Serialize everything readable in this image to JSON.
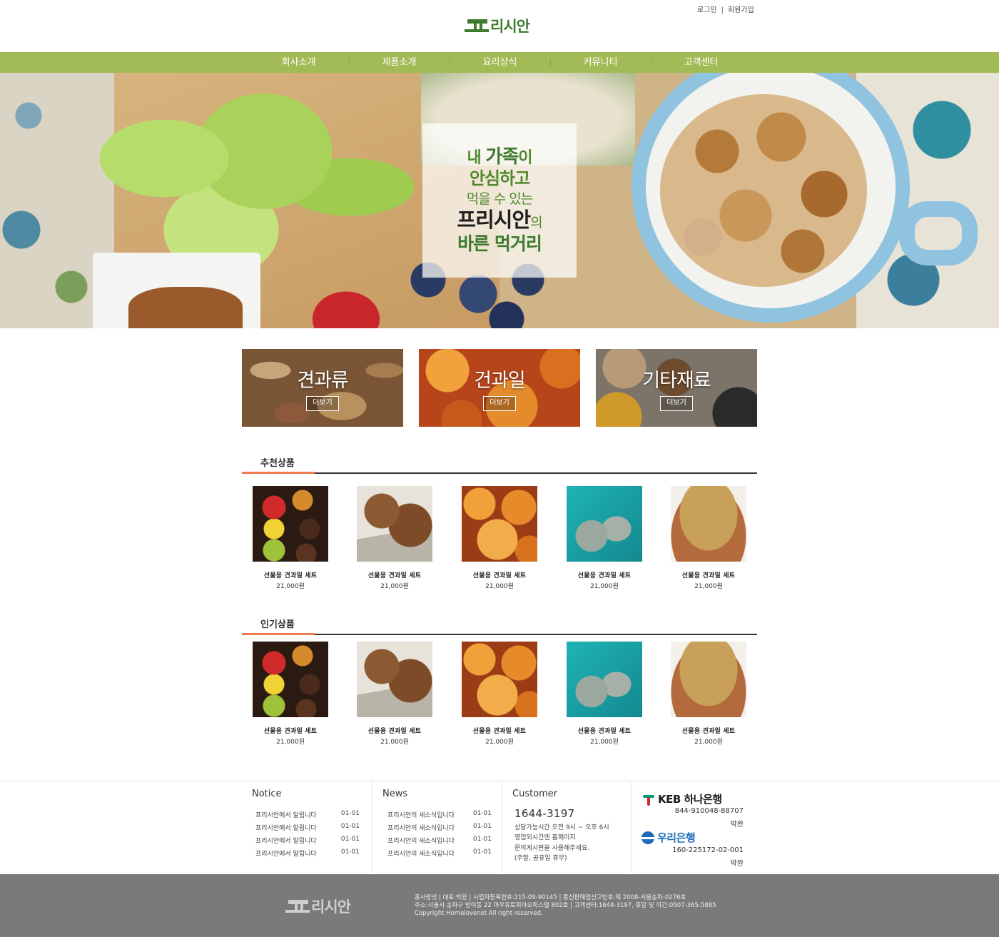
{
  "header": {
    "login_label": "로그인",
    "separator": "|",
    "signup_label": "회원가입",
    "logo_text": "리시안"
  },
  "nav": {
    "items": [
      {
        "label": "회사소개"
      },
      {
        "label": "제품소개"
      },
      {
        "label": "요리상식"
      },
      {
        "label": "커뮤니티"
      },
      {
        "label": "고객센터"
      }
    ]
  },
  "hero": {
    "line1_a": "내 ",
    "line1_b": "가족",
    "line1_c": "이",
    "line2": "안심하고",
    "line3": "먹을 수 있는",
    "line4_a": "프리시안",
    "line4_b": "의",
    "line5": "바른 먹거리"
  },
  "categories": [
    {
      "title": "견과류",
      "button": "더보기"
    },
    {
      "title": "건과일",
      "button": "더보기"
    },
    {
      "title": "기타재료",
      "button": "더보기"
    }
  ],
  "recommended": {
    "title": "추천상품",
    "items": [
      {
        "name": "선물용 견과일 세트",
        "price": "21,000원"
      },
      {
        "name": "선물용 견과일 세트",
        "price": "21,000원"
      },
      {
        "name": "선물용 견과일 세트",
        "price": "21,000원"
      },
      {
        "name": "선물용 견과일 세트",
        "price": "21,000원"
      },
      {
        "name": "선물용 견과일 세트",
        "price": "21,000원"
      }
    ]
  },
  "popular": {
    "title": "인기상품",
    "items": [
      {
        "name": "선물용 견과일 세트",
        "price": "21,000원"
      },
      {
        "name": "선물용 견과일 세트",
        "price": "21,000원"
      },
      {
        "name": "선물용 견과일 세트",
        "price": "21,000원"
      },
      {
        "name": "선물용 견과일 세트",
        "price": "21,000원"
      },
      {
        "name": "선물용 견과일 세트",
        "price": "21,000원"
      }
    ]
  },
  "notice": {
    "title": "Notice",
    "items": [
      {
        "text": "프리시안에서 알립니다",
        "date": "01-01"
      },
      {
        "text": "프리시안에서 알립니다",
        "date": "01-01"
      },
      {
        "text": "프리시안에서 알립니다",
        "date": "01-01"
      },
      {
        "text": "프리시안에서 알립니다",
        "date": "01-01"
      }
    ]
  },
  "news": {
    "title": "News",
    "items": [
      {
        "text": "프리시안의 새소식입니다",
        "date": "01-01"
      },
      {
        "text": "프리시안의 새소식입니다",
        "date": "01-01"
      },
      {
        "text": "프리시안의 새소식입니다",
        "date": "01-01"
      },
      {
        "text": "프리시안의 새소식입니다",
        "date": "01-01"
      }
    ]
  },
  "customer": {
    "title": "Customer",
    "phone": "1644-3197",
    "lines": [
      "상담가능시간 오전 9시 ~ 오후 6시",
      "영업외시간엔 홈페이지",
      "문의게시판을 사용해주세요.",
      "(주말, 공휴일 휴무)"
    ]
  },
  "banks": {
    "keb_name": "KEB 하나은행",
    "keb_account": "844-910048-88707",
    "keb_holder": "박완",
    "woori_name": "우리은행",
    "woori_account": "160-225172-02-001",
    "woori_holder": "박완"
  },
  "footer": {
    "logo_text": "리시안",
    "line1": "홈사랑넷  |  대표:박완  |  사업자등록번호:215-09-90145 | 통신판매업신고번호:제 2008-서울송파-0276호",
    "line2": "주소:서울시 송파구 방이동 22 마우유토피아오피스텔 802호 | 고객센터:1644-3197, 휴일 및 야간:0507-365-5885",
    "line3": "Copyright Homelovenet All right reserved."
  },
  "colors": {
    "nav_green": "#a3bb56",
    "logo_green": "#3c7a2c",
    "accent_orange": "#ef7a52",
    "footer_gray": "#7a7a7a"
  }
}
